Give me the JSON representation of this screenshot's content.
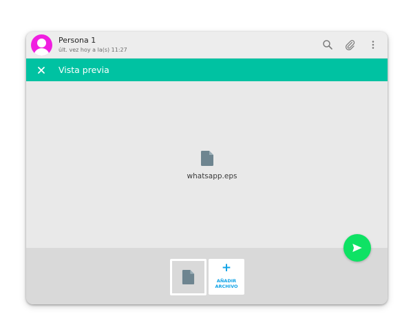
{
  "header": {
    "contact_name": "Persona 1",
    "last_seen": "últ. vez hoy a la(s) 11:27",
    "icons": [
      "avatar-icon",
      "search-icon",
      "paperclip-icon",
      "more-vert-icon"
    ]
  },
  "preview_bar": {
    "title": "Vista previa",
    "close_icon": "close-icon"
  },
  "preview": {
    "file_name": "whatsapp.eps",
    "file_icon": "document-icon"
  },
  "tray": {
    "add_plus": "+",
    "add_label_line1": "AÑADIR",
    "add_label_line2": "ARCHIVO"
  },
  "send": {
    "icon": "send-icon"
  },
  "colors": {
    "accent": "#00c2a2",
    "send": "#0ee264",
    "avatar": "#f01ee0",
    "add_text": "#11a3e6",
    "doc_icon": "#6e8590"
  }
}
